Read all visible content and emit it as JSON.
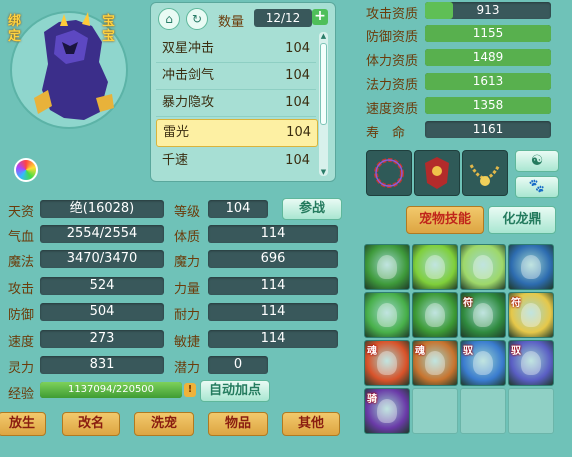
{
  "pet": {
    "bound_label": "绑定",
    "baby_label": "宝宝"
  },
  "list_header": {
    "count_label": "数量",
    "count_value": "12/12"
  },
  "pet_list": [
    {
      "name": "双星冲击",
      "level": "104",
      "selected": false
    },
    {
      "name": "冲击剑气",
      "level": "104",
      "selected": false
    },
    {
      "name": "暴力隐攻",
      "level": "104",
      "selected": false
    },
    {
      "name": "雷光",
      "level": "104",
      "selected": true
    },
    {
      "name": "千速",
      "level": "104",
      "selected": false
    }
  ],
  "stats": {
    "tianzi": {
      "label": "天资",
      "value": "绝(16028)"
    },
    "level": {
      "label": "等级",
      "value": "104"
    },
    "battle_button": "参战",
    "hp": {
      "label": "气血",
      "value": "2554/2554"
    },
    "tizhi": {
      "label": "体质",
      "value": "114"
    },
    "mp": {
      "label": "魔法",
      "value": "3470/3470"
    },
    "moli": {
      "label": "魔力",
      "value": "696"
    },
    "attack": {
      "label": "攻击",
      "value": "524"
    },
    "liliang": {
      "label": "力量",
      "value": "114"
    },
    "defense": {
      "label": "防御",
      "value": "504"
    },
    "naili": {
      "label": "耐力",
      "value": "114"
    },
    "speed": {
      "label": "速度",
      "value": "273"
    },
    "minjie": {
      "label": "敏捷",
      "value": "114"
    },
    "lingli": {
      "label": "灵力",
      "value": "831"
    },
    "qianli": {
      "label": "潜力",
      "value": "0"
    },
    "exp": {
      "label": "经验",
      "value": "1137094/220500",
      "fill": 1.0
    },
    "auto_points_button": "自动加点"
  },
  "bottom_buttons": [
    "放生",
    "改名",
    "洗宠",
    "物品",
    "其他"
  ],
  "aptitudes": [
    {
      "label": "攻击资质",
      "value": "913",
      "fill": 0.22,
      "color": "#5fbf55"
    },
    {
      "label": "防御资质",
      "value": "1155",
      "fill": 1.0,
      "color": "#58b04e"
    },
    {
      "label": "体力资质",
      "value": "1489",
      "fill": 1.0,
      "color": "#58b04e"
    },
    {
      "label": "法力资质",
      "value": "1613",
      "fill": 1.0,
      "color": "#58b04e"
    },
    {
      "label": "速度资质",
      "value": "1358",
      "fill": 1.0,
      "color": "#58b04e"
    },
    {
      "label": "寿　命",
      "value": "1161",
      "fill": 0,
      "color": "#39585b"
    }
  ],
  "tabs": {
    "skills": "宠物技能",
    "dragon": "化龙鼎"
  },
  "skills": [
    {
      "icon": "green-figure-skill-icon",
      "bg": "#3e9a3a",
      "tag": ""
    },
    {
      "icon": "leaf-storm-skill-icon",
      "bg": "#7fcf3a",
      "tag": ""
    },
    {
      "icon": "palm-skill-icon",
      "bg": "#9ed86a",
      "tag": ""
    },
    {
      "icon": "dark-vortex-skill-icon",
      "bg": "#2d6cb0",
      "tag": ""
    },
    {
      "icon": "hand-glow-skill-icon",
      "bg": "#48b04a",
      "tag": ""
    },
    {
      "icon": "bell-skill-icon",
      "bg": "#3c9a34",
      "tag": ""
    },
    {
      "icon": "cat-spirit-skill-icon",
      "bg": "#2f8a3e",
      "tag": "符"
    },
    {
      "icon": "hand-talisman-skill-icon",
      "bg": "#e6c84a",
      "tag": "符"
    },
    {
      "icon": "flame-skill-icon",
      "bg": "#d9532a",
      "tag": "魂"
    },
    {
      "icon": "muscle-skill-icon",
      "bg": "#c8742f",
      "tag": "魂"
    },
    {
      "icon": "blue-butterfly-skill-icon",
      "bg": "#3a7ccf",
      "tag": "驭"
    },
    {
      "icon": "wolf-skill-icon",
      "bg": "#5a5ec4",
      "tag": "驭"
    },
    {
      "icon": "purple-orb-skill-icon",
      "bg": "#6a3aa8",
      "tag": "骑"
    },
    {
      "icon": "empty-slot",
      "bg": "",
      "tag": ""
    },
    {
      "icon": "empty-slot",
      "bg": "",
      "tag": ""
    },
    {
      "icon": "empty-slot",
      "bg": "",
      "tag": ""
    }
  ],
  "colors": {
    "accent": "#ffd23f",
    "panel": "#a7dfd4",
    "value_bg": "#39585b"
  }
}
